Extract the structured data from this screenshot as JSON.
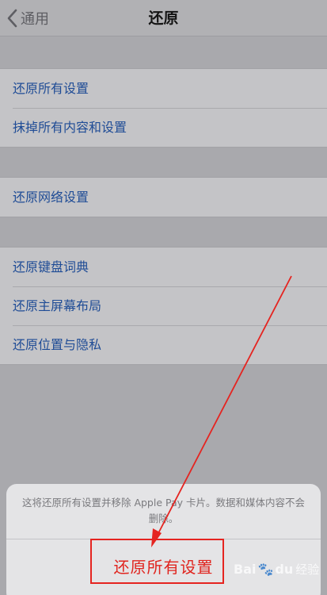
{
  "navbar": {
    "back_label": "通用",
    "title": "还原"
  },
  "groups": [
    {
      "items": [
        {
          "label": "还原所有设置"
        },
        {
          "label": "抹掉所有内容和设置"
        }
      ]
    },
    {
      "items": [
        {
          "label": "还原网络设置"
        }
      ]
    },
    {
      "items": [
        {
          "label": "还原键盘词典"
        },
        {
          "label": "还原主屏幕布局"
        },
        {
          "label": "还原位置与隐私"
        }
      ]
    }
  ],
  "action_sheet": {
    "message": "这将还原所有设置并移除 Apple Pay 卡片。数据和媒体内容不会删除。",
    "confirm_label": "还原所有设置"
  },
  "watermark": {
    "brand_left": "Bai",
    "brand_right": "经验",
    "paw": "du"
  },
  "colors": {
    "link": "#1f4c96",
    "destructive": "#e0241e",
    "annotation": "#e52420"
  }
}
